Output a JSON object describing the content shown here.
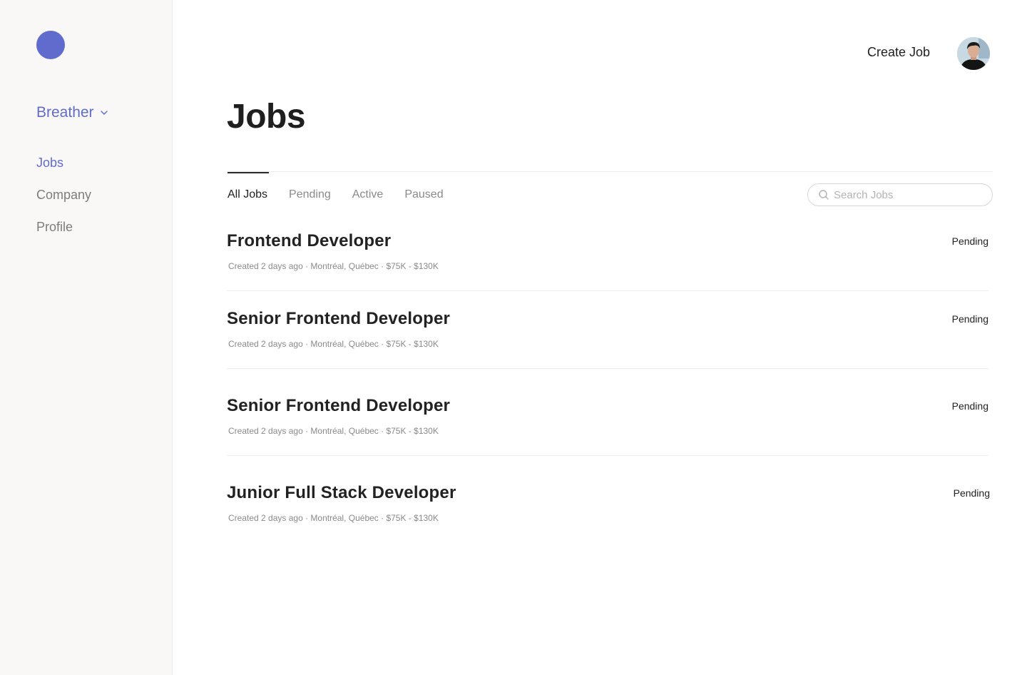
{
  "sidebar": {
    "org_name": "Breather",
    "nav": [
      {
        "label": "Jobs",
        "active": true
      },
      {
        "label": "Company",
        "active": false
      },
      {
        "label": "Profile",
        "active": false
      }
    ]
  },
  "header": {
    "create_job_label": "Create Job",
    "avatar_icon": "user-avatar"
  },
  "page": {
    "title": "Jobs"
  },
  "tabs": [
    {
      "label": "All Jobs",
      "active": true
    },
    {
      "label": "Pending",
      "active": false
    },
    {
      "label": "Active",
      "active": false
    },
    {
      "label": "Paused",
      "active": false
    }
  ],
  "search": {
    "placeholder": "Search Jobs",
    "value": ""
  },
  "jobs": [
    {
      "title": "Frontend Developer",
      "meta": "Created 2 days ago · Montréal, Québec · $75K - $130K",
      "status": "Pending"
    },
    {
      "title": "Senior Frontend Developer",
      "meta": "Created 2 days ago · Montréal, Québec · $75K - $130K",
      "status": "Pending"
    },
    {
      "title": "Senior Frontend Developer",
      "meta": "Created 2 days ago · Montréal, Québec · $75K - $130K",
      "status": "Pending"
    },
    {
      "title": "Junior Full Stack Developer",
      "meta": "Created 2 days ago · Montréal, Québec · $75K - $130K",
      "status": "Pending"
    }
  ],
  "colors": {
    "accent": "#5f6ccd",
    "sidebar_bg": "#f9f8f7",
    "text": "#1f1f1f",
    "muted": "#8a8a8a"
  }
}
